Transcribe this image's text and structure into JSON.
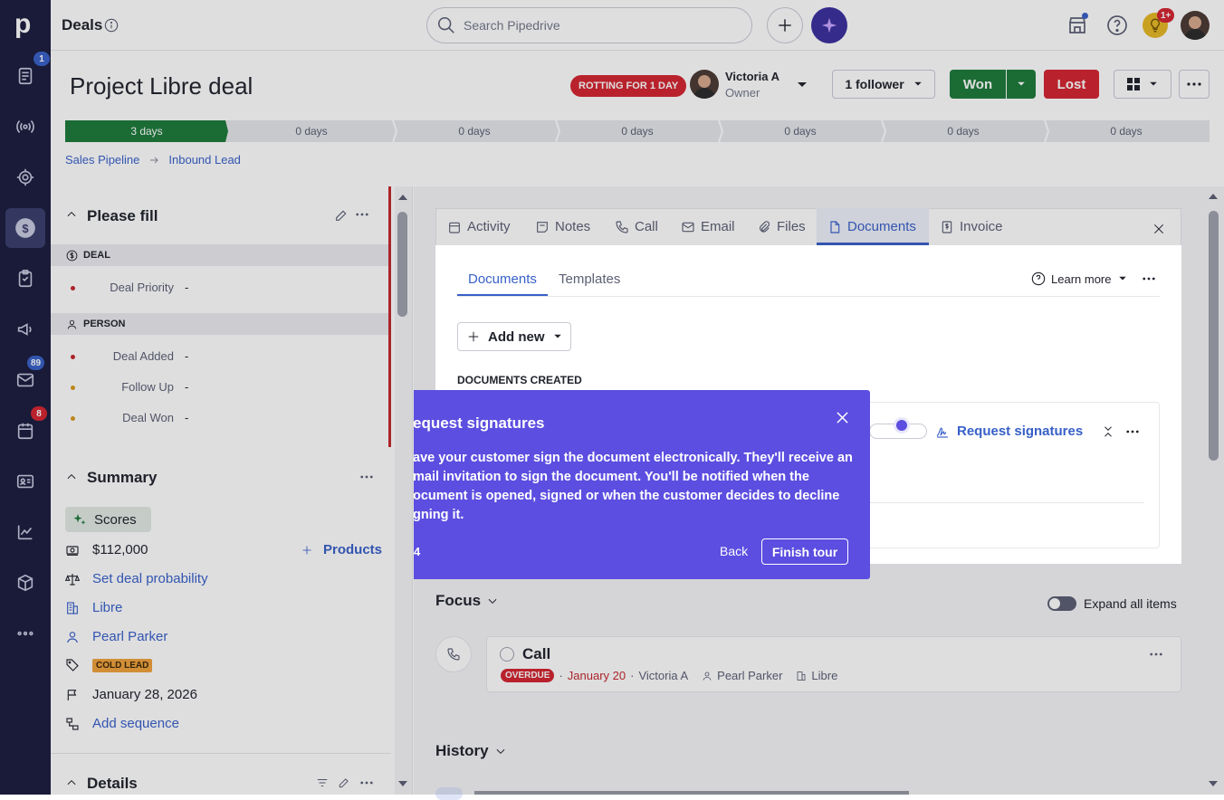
{
  "nav": {
    "logo": "p",
    "badges": {
      "leads": "1",
      "mail": "89",
      "calendar": "8"
    }
  },
  "topbar": {
    "title": "Deals",
    "search_placeholder": "Search Pipedrive",
    "notif_badge": "1+"
  },
  "deal": {
    "title": "Project Libre deal",
    "rotting": "ROTTING FOR 1 DAY",
    "owner_name": "Victoria A",
    "owner_role": "Owner",
    "follower": "1 follower",
    "won": "Won",
    "lost": "Lost",
    "stages": [
      "3 days",
      "0 days",
      "0 days",
      "0 days",
      "0 days",
      "0 days",
      "0 days"
    ],
    "breadcrumb": [
      "Sales Pipeline",
      "Inbound Lead"
    ]
  },
  "please_fill": {
    "title": "Please fill",
    "deal_label": "DEAL",
    "person_label": "PERSON",
    "fields": [
      {
        "label": "Deal Priority",
        "value": "-",
        "dot": "#c4272c"
      },
      {
        "label": "Deal Added",
        "value": "-",
        "dot": "#c4272c"
      },
      {
        "label": "Follow Up",
        "value": "-",
        "dot": "#d99a1e"
      },
      {
        "label": "Deal Won",
        "value": "-",
        "dot": "#d99a1e"
      }
    ]
  },
  "summary": {
    "title": "Summary",
    "scores": "Scores",
    "value": "$112,000",
    "products": "Products",
    "probability": "Set deal probability",
    "org": "Libre",
    "person": "Pearl Parker",
    "label": "COLD LEAD",
    "close_date": "January 28, 2026",
    "sequence": "Add sequence"
  },
  "details": {
    "title": "Details"
  },
  "tabs": [
    "Activity",
    "Notes",
    "Call",
    "Email",
    "Files",
    "Documents",
    "Invoice"
  ],
  "documents": {
    "subtabs": [
      "Documents",
      "Templates"
    ],
    "learn_more": "Learn more",
    "add_new": "Add new",
    "created_label": "DOCUMENTS CREATED",
    "request_signatures": "Request signatures"
  },
  "tour": {
    "title": "equest signatures",
    "body": "ave your customer sign the document electronically. They'll receive an\nmail invitation to sign the document. You'll be notified when the\nocument is opened, signed or when the customer decides to decline\ngning it.",
    "step": "4",
    "back": "Back",
    "finish": "Finish tour"
  },
  "focus": {
    "title": "Focus",
    "expand": "Expand all items",
    "activity": {
      "title": "Call",
      "status": "OVERDUE",
      "date": "January 20",
      "owner": "Victoria A",
      "person": "Pearl Parker",
      "org": "Libre"
    }
  },
  "history": {
    "title": "History"
  },
  "colors": {
    "rail": "#1a1d3d",
    "won": "#1c7a3a",
    "lost": "#d4252f",
    "tour": "#5c4ee0",
    "link": "#3860c8",
    "rotting": "#d4252f"
  }
}
